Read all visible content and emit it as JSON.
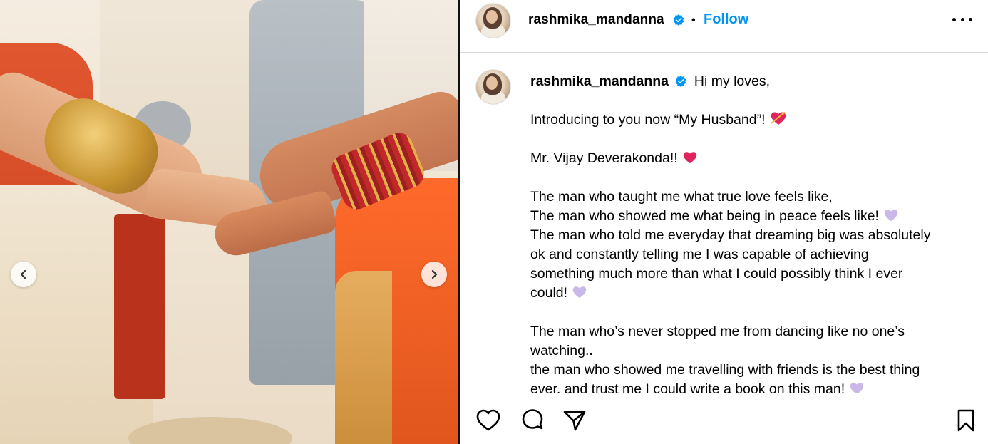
{
  "post": {
    "username": "rashmika_mandanna",
    "dot": "•",
    "follow_label": "Follow",
    "avatar_alt": "rashmika_mandanna profile picture"
  },
  "caption": {
    "username": "rashmika_mandanna",
    "greeting": "Hi my loves,",
    "lines": [
      "Introducing to you now “My Husband”!",
      "Mr. Vijay Deverakonda!!",
      "The man who taught me what true love feels like,",
      "The man who showed me what being in peace feels like!",
      "The man who told me everyday that dreaming big was absolutely",
      "ok and constantly telling me I was capable of achieving",
      "something much more than what I could possibly think I ever",
      "could!",
      "The man who’s never stopped me from dancing like no one’s",
      "watching..",
      "the man who showed me travelling with friends is the best thing",
      "ever, and trust me I could write a book on this man!"
    ]
  },
  "icons": {
    "more": "more-options-icon",
    "verified": "verified-badge-icon",
    "prev": "chevron-left-icon",
    "next": "chevron-right-icon",
    "like": "heart-icon",
    "comment": "comment-icon",
    "share": "share-icon",
    "save": "bookmark-icon"
  },
  "colors": {
    "follow": "#0095f6",
    "verified": "#0095f6",
    "heart_emoji": "#e0245e",
    "lilac_heart": "#c9b8e8"
  }
}
